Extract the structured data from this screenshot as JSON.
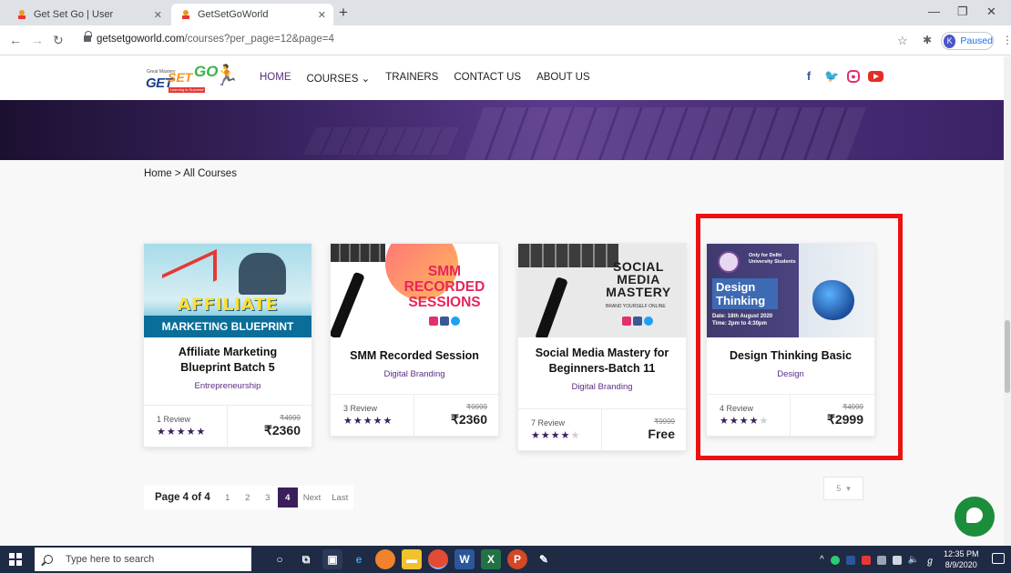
{
  "browser": {
    "tabs": [
      {
        "title": "Get Set Go | User",
        "active": false
      },
      {
        "title": "GetSetGoWorld",
        "active": true
      }
    ],
    "url": {
      "domain": "getsetgoworld.com",
      "path": "/courses?per_page=12&page=4"
    },
    "profile": {
      "initial": "K",
      "status": "Paused"
    }
  },
  "site": {
    "logo": {
      "get": "GET",
      "set": "SET",
      "go": "GO",
      "tiny": "Great Mastery",
      "tag": "Learning to Succeed"
    },
    "nav": [
      {
        "label": "HOME",
        "active": true
      },
      {
        "label": "COURSES ⌄",
        "active": false
      },
      {
        "label": "TRAINERS",
        "active": false
      },
      {
        "label": "CONTACT US",
        "active": false
      },
      {
        "label": "ABOUT US",
        "active": false
      }
    ],
    "socials": [
      "facebook-icon",
      "twitter-icon",
      "instagram-icon",
      "youtube-icon"
    ]
  },
  "breadcrumb": "Home > All Courses",
  "courses": [
    {
      "title": "Affiliate Marketing Blueprint Batch 5",
      "category": "Entrepreneurship",
      "reviews": "1 Review",
      "rating": 5,
      "old_price": "₹4999",
      "price": "₹2360",
      "thumb": {
        "line1": "AFFILIATE",
        "line2": "MARKETING BLUEPRINT"
      }
    },
    {
      "title": "SMM Recorded Session",
      "category": "Digital Branding",
      "reviews": "3 Review",
      "rating": 5,
      "old_price": "₹9999",
      "price": "₹2360",
      "thumb": {
        "line1": "SMM",
        "line2": "RECORDED",
        "line3": "SESSIONS"
      }
    },
    {
      "title": "Social Media Mastery for Beginners-Batch 11",
      "category": "Digital Branding",
      "reviews": "7 Review",
      "rating": 4,
      "old_price": "₹9999",
      "price": "Free",
      "thumb": {
        "line1": "SOCIAL",
        "line2": "MEDIA",
        "line3": "MASTERY",
        "tag": "BRAND YOURSELF ONLINE"
      }
    },
    {
      "title": "Design Thinking Basic",
      "category": "Design",
      "reviews": "4 Review",
      "rating": 4,
      "old_price": "₹4999",
      "price": "₹2999",
      "thumb": {
        "only1": "Only for Delhi",
        "only2": "University Students",
        "line1": "Design",
        "line2": "Thinking",
        "date1": "Date: 18th August 2020",
        "date2": "Time: 2pm to 4:30pm"
      }
    }
  ],
  "pagination": {
    "label": "Page 4 of 4",
    "pages": [
      "1",
      "2",
      "3",
      "4"
    ],
    "current": "4",
    "next": "Next",
    "last": "Last"
  },
  "per_page": {
    "value": "5",
    "caret": "▾"
  },
  "taskbar": {
    "search_placeholder": "Type here to search",
    "time": "12:35 PM",
    "date": "8/9/2020"
  },
  "colors": {
    "accent": "#3a1f5c",
    "highlight": "#ee1111",
    "chat": "#1a8e3b"
  }
}
